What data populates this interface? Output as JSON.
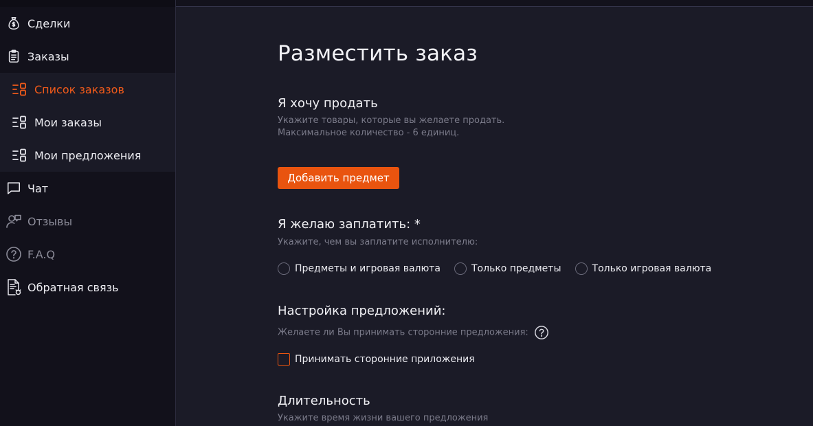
{
  "sidebar": {
    "items": [
      {
        "label": "Сделки",
        "icon": "money-bag-icon"
      },
      {
        "label": "Заказы",
        "icon": "clipboard-icon"
      },
      {
        "label": "Чат",
        "icon": "chat-bubble-icon"
      },
      {
        "label": "Отзывы",
        "icon": "user-review-icon"
      },
      {
        "label": "F.A.Q",
        "icon": "question-circle-icon"
      },
      {
        "label": "Обратная связь",
        "icon": "feedback-document-icon"
      }
    ],
    "sub_items": [
      {
        "label": "Список заказов",
        "icon": "list-icon",
        "active": true
      },
      {
        "label": "Мои заказы",
        "icon": "list-icon"
      },
      {
        "label": "Мои предложения",
        "icon": "list-icon"
      }
    ]
  },
  "main": {
    "title": "Разместить заказ",
    "sell": {
      "title": "Я хочу продать",
      "hint_line1": "Укажите товары, которые вы желаете продать.",
      "hint_line2": "Максимальное количество - 6 единиц.",
      "add_button": "Добавить предмет"
    },
    "pay": {
      "title": "Я желаю заплатить: *",
      "hint": "Укажите, чем вы заплатите исполнителю:",
      "options": [
        "Предметы и игровая валюта",
        "Только предметы",
        "Только игровая валюта"
      ]
    },
    "offers": {
      "title": "Настройка предложений:",
      "hint": "Желаете ли Вы принимать сторонние предложения:",
      "checkbox_label": "Принимать сторонние приложения"
    },
    "duration": {
      "title": "Длительность",
      "hint": "Укажите время жизни вашего предложения"
    }
  },
  "colors": {
    "accent": "#e9540f",
    "active_text": "#f05a1a",
    "background": "#1b1b27",
    "sidebar": "#12111b"
  }
}
